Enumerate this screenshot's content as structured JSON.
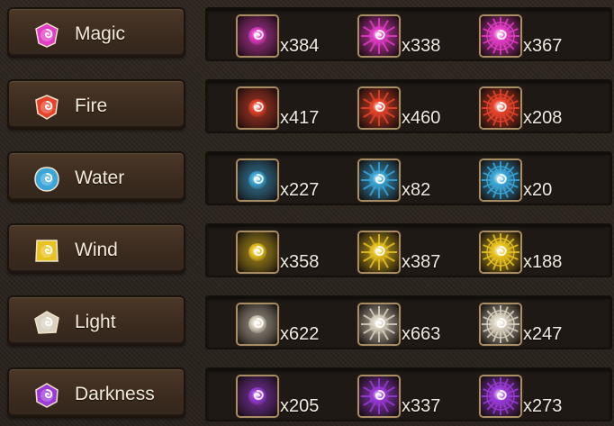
{
  "rows": [
    {
      "label": "Magic",
      "icon": "magic-element-icon",
      "color": "#e33cc6",
      "items": [
        {
          "icon": "magic-essence-low-icon",
          "qty": "x384"
        },
        {
          "icon": "magic-essence-mid-icon",
          "qty": "x338"
        },
        {
          "icon": "magic-essence-high-icon",
          "qty": "x367"
        }
      ]
    },
    {
      "label": "Fire",
      "icon": "fire-element-icon",
      "color": "#e8432a",
      "items": [
        {
          "icon": "fire-essence-low-icon",
          "qty": "x417"
        },
        {
          "icon": "fire-essence-mid-icon",
          "qty": "x460"
        },
        {
          "icon": "fire-essence-high-icon",
          "qty": "x208"
        }
      ]
    },
    {
      "label": "Water",
      "icon": "water-element-icon",
      "color": "#3aa6d8",
      "items": [
        {
          "icon": "water-essence-low-icon",
          "qty": "x227"
        },
        {
          "icon": "water-essence-mid-icon",
          "qty": "x82"
        },
        {
          "icon": "water-essence-high-icon",
          "qty": "x20"
        }
      ]
    },
    {
      "label": "Wind",
      "icon": "wind-element-icon",
      "color": "#e8c21e",
      "items": [
        {
          "icon": "wind-essence-low-icon",
          "qty": "x358"
        },
        {
          "icon": "wind-essence-mid-icon",
          "qty": "x387"
        },
        {
          "icon": "wind-essence-high-icon",
          "qty": "x188"
        }
      ]
    },
    {
      "label": "Light",
      "icon": "light-element-icon",
      "color": "#d9d2c0",
      "items": [
        {
          "icon": "light-essence-low-icon",
          "qty": "x622"
        },
        {
          "icon": "light-essence-mid-icon",
          "qty": "x663"
        },
        {
          "icon": "light-essence-high-icon",
          "qty": "x247"
        }
      ]
    },
    {
      "label": "Darkness",
      "icon": "darkness-element-icon",
      "color": "#9b3ad8",
      "items": [
        {
          "icon": "darkness-essence-low-icon",
          "qty": "x205"
        },
        {
          "icon": "darkness-essence-mid-icon",
          "qty": "x337"
        },
        {
          "icon": "darkness-essence-high-icon",
          "qty": "x273"
        }
      ]
    }
  ]
}
